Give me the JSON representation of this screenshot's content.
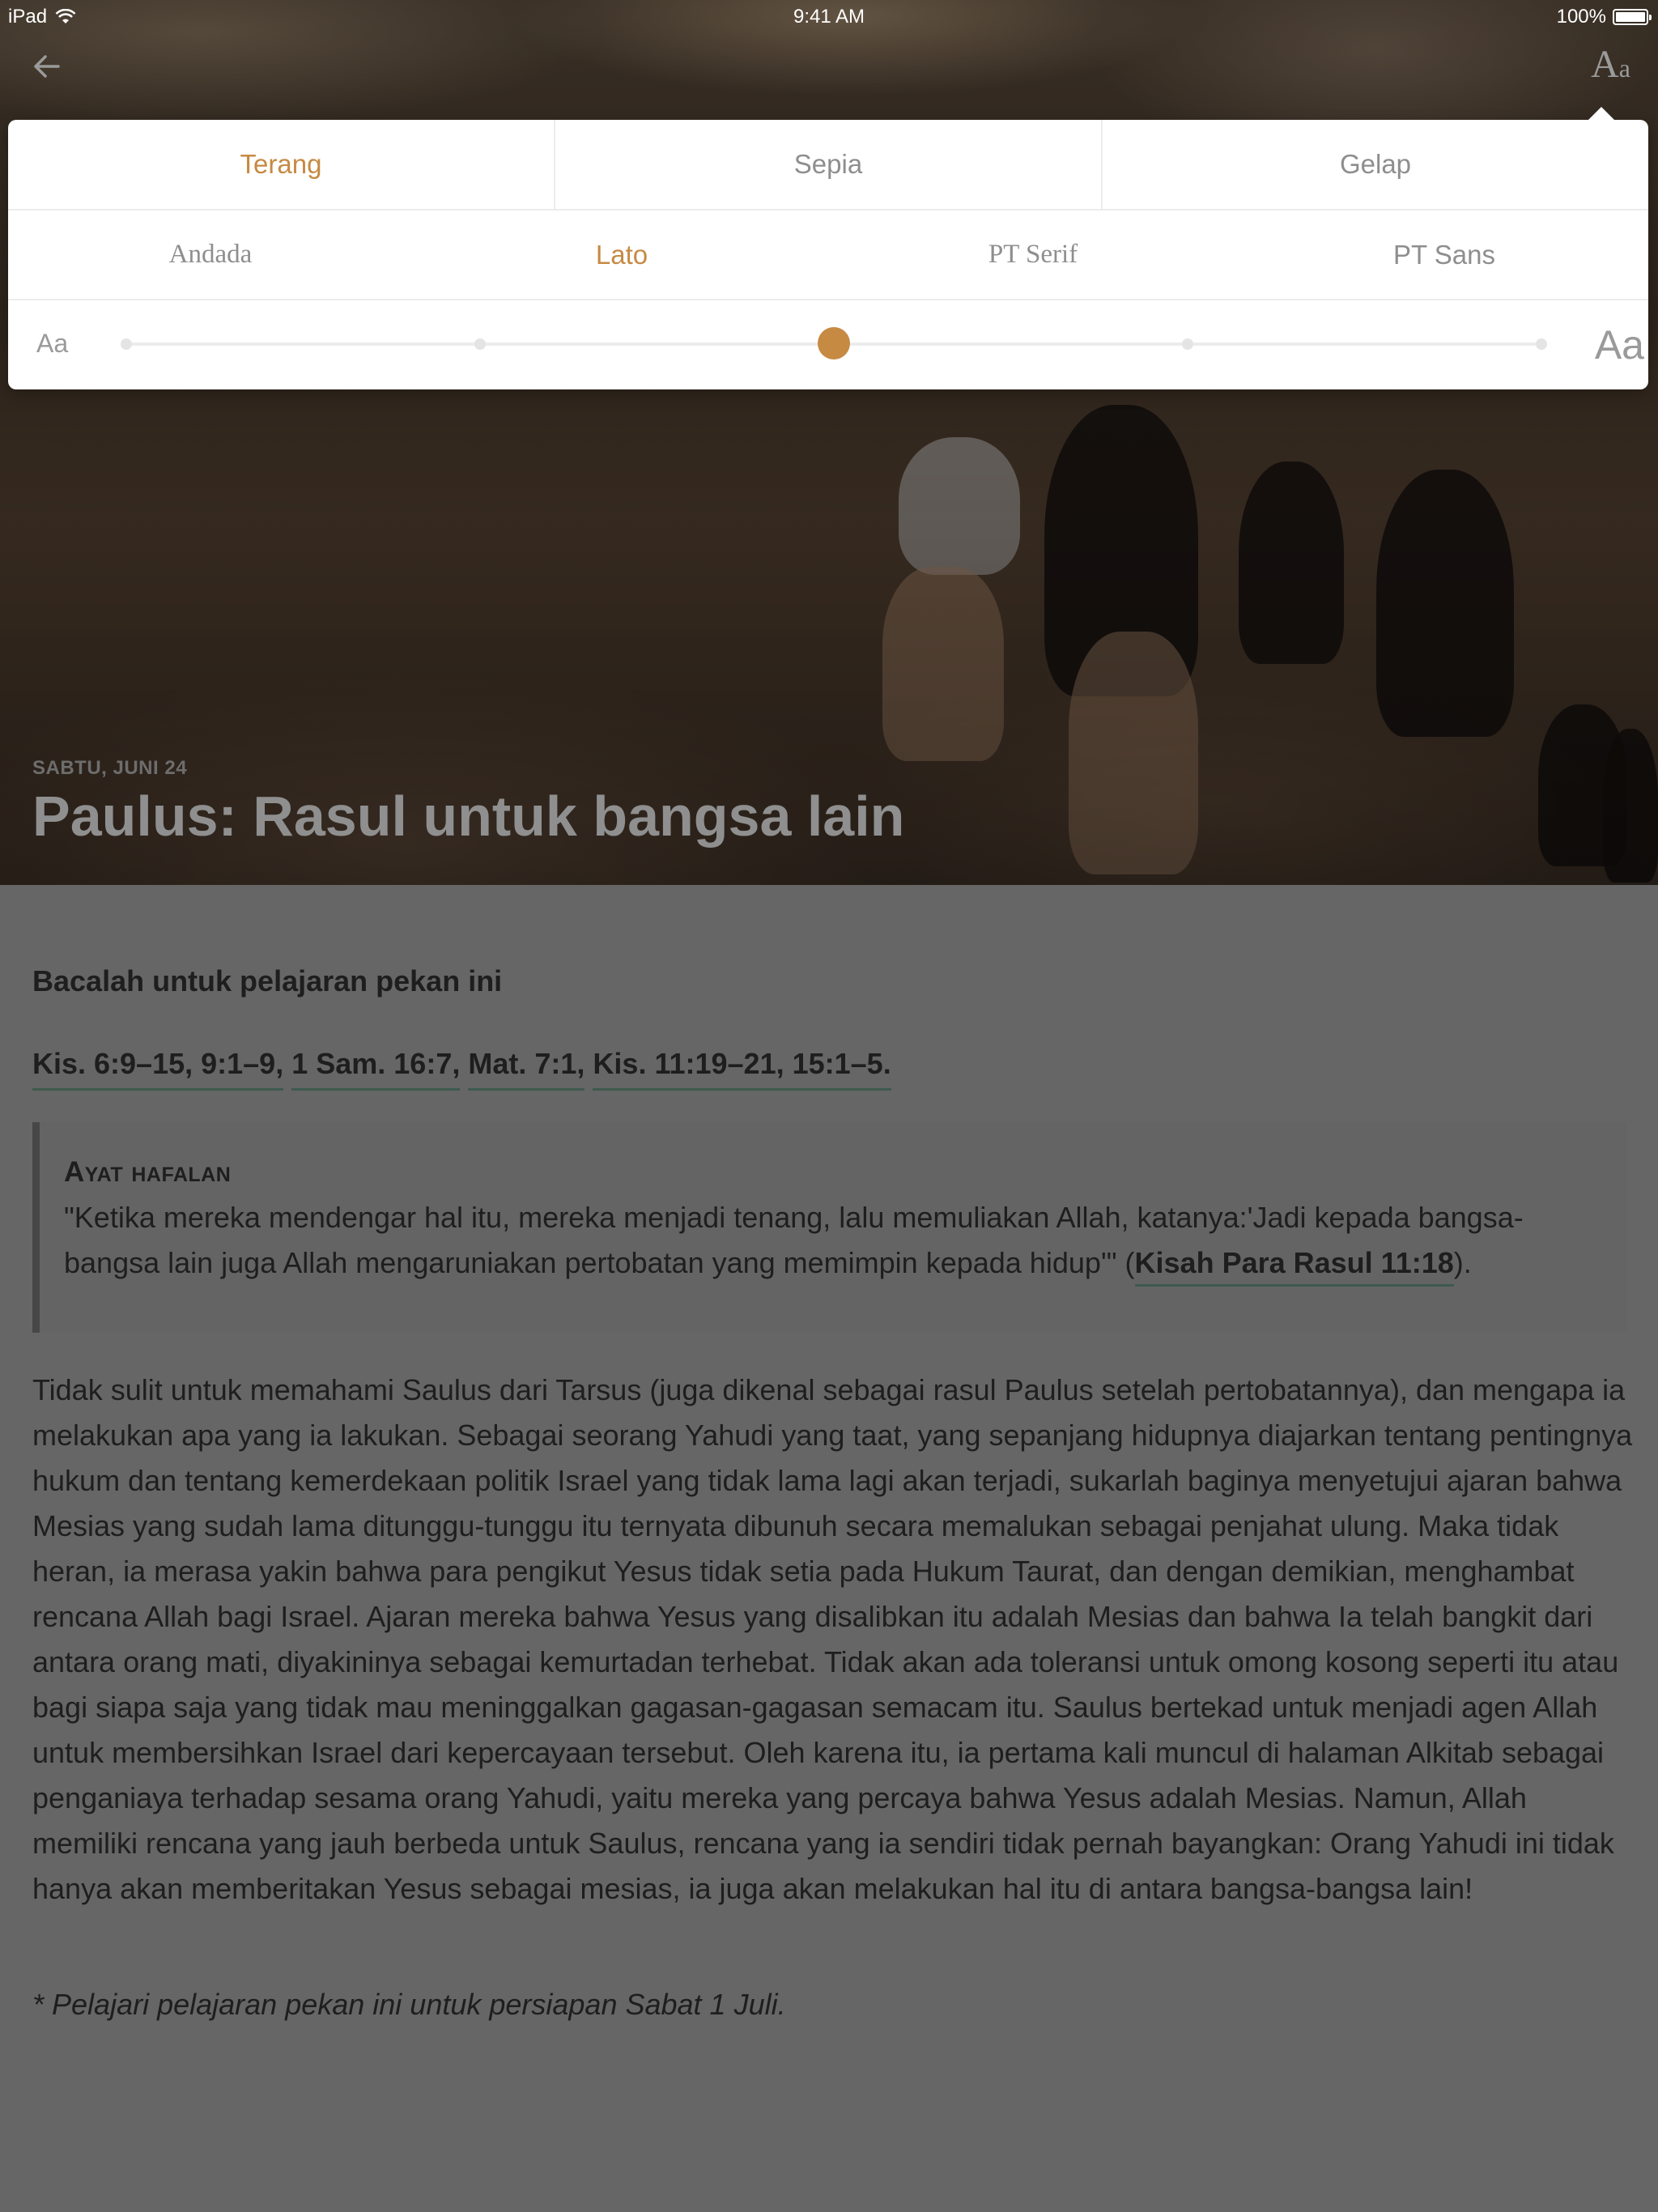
{
  "status_bar": {
    "device": "iPad",
    "time": "9:41 AM",
    "battery": "100%"
  },
  "nav": {
    "back_icon": "back-arrow-icon",
    "text_settings_big": "A",
    "text_settings_small": "a"
  },
  "settings": {
    "themes": [
      "Terang",
      "Sepia",
      "Gelap"
    ],
    "selected_theme": "Terang",
    "fonts": [
      "Andada",
      "Lato",
      "PT Serif",
      "PT Sans"
    ],
    "selected_font": "Lato",
    "size_small_label": "Aa",
    "size_large_label": "Aa",
    "size_levels": 5,
    "size_selected_index": 2,
    "accent_color": "#c68a43"
  },
  "hero": {
    "date": "SABTU, JUNI 24",
    "title": "Paulus: Rasul untuk bangsa lain"
  },
  "content": {
    "read_heading": "Bacalah untuk pelajaran pekan ini",
    "refs": [
      "Kis. 6:9–15, 9:1–9,",
      "1 Sam. 16:7,",
      "Mat. 7:1,",
      "Kis. 11:19–21, 15:1–5."
    ],
    "memory_title": "Ayat hafalan",
    "memory_text": "\"Ketika mereka mendengar hal itu, mereka menjadi tenang, lalu memuliakan Allah, katanya:'Jadi kepada bangsa-bangsa lain juga Allah mengaruniakan pertobatan yang memimpin kepada hidup'\" (",
    "memory_ref": "Kisah Para Rasul 11:18",
    "memory_close": ").",
    "body": "Tidak sulit untuk memahami Saulus dari Tarsus (juga dikenal sebagai rasul Paulus setelah pertobatannya), dan mengapa ia melakukan apa yang ia lakukan. Sebagai seorang Yahudi yang taat, yang sepanjang hidupnya diajarkan tentang pentingnya hukum dan tentang kemerdekaan politik Israel yang tidak lama lagi akan terjadi, sukarlah baginya menyetujui ajaran bahwa Mesias yang sudah lama ditunggu-tunggu itu ternyata dibunuh secara memalukan sebagai penjahat ulung. Maka tidak heran, ia merasa yakin bahwa para pengikut Yesus tidak setia pada Hukum Taurat, dan dengan demikian, menghambat rencana Allah bagi Israel. Ajaran mereka bahwa Yesus yang disalibkan itu adalah Mesias dan bahwa Ia telah bangkit dari antara orang mati, diyakininya sebagai kemurtadan terhebat. Tidak akan ada toleransi untuk omong kosong seperti itu atau bagi siapa saja yang tidak mau meninggalkan gagasan-gagasan semacam itu. Saulus bertekad untuk menjadi agen Allah untuk membersihkan Israel dari kepercayaan tersebut. Oleh karena itu, ia pertama kali muncul di halaman Alkitab sebagai penganiaya terhadap sesama orang Yahudi, yaitu mereka yang percaya bahwa Yesus adalah Mesias. Namun, Allah memiliki rencana yang jauh berbeda untuk Saulus, rencana yang ia sendiri tidak pernah bayangkan: Orang Yahudi ini tidak hanya akan memberitakan Yesus sebagai mesias, ia juga akan melakukan hal itu di antara bangsa-bangsa lain!",
    "note": "* Pelajari pelajaran pekan ini untuk persiapan Sabat 1 Juli."
  }
}
